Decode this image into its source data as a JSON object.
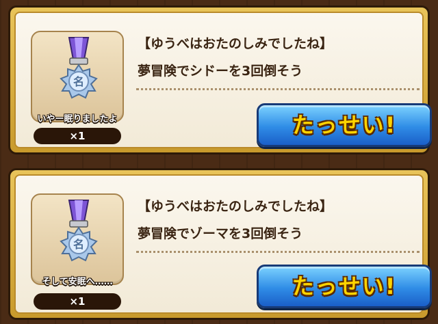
{
  "missions": [
    {
      "title": "【ゆうべはおたのしみでしたね】",
      "description": "夢冒険でシドーを3回倒そう",
      "reward_name": "いやー眠りましたよ",
      "reward_count": "×1",
      "medal_glyph": "名",
      "button_label": "たっせい!"
    },
    {
      "title": "【ゆうべはおたのしみでしたね】",
      "description": "夢冒険でゾーマを3回倒そう",
      "reward_name": "そして安眠へ……",
      "reward_count": "×1",
      "medal_glyph": "名",
      "button_label": "たっせい!"
    }
  ],
  "icons": {
    "reward": "title-medal-icon"
  },
  "colors": {
    "button": "#2f8ce6",
    "button_text": "#ffd400",
    "frame": "#c89a2c"
  }
}
